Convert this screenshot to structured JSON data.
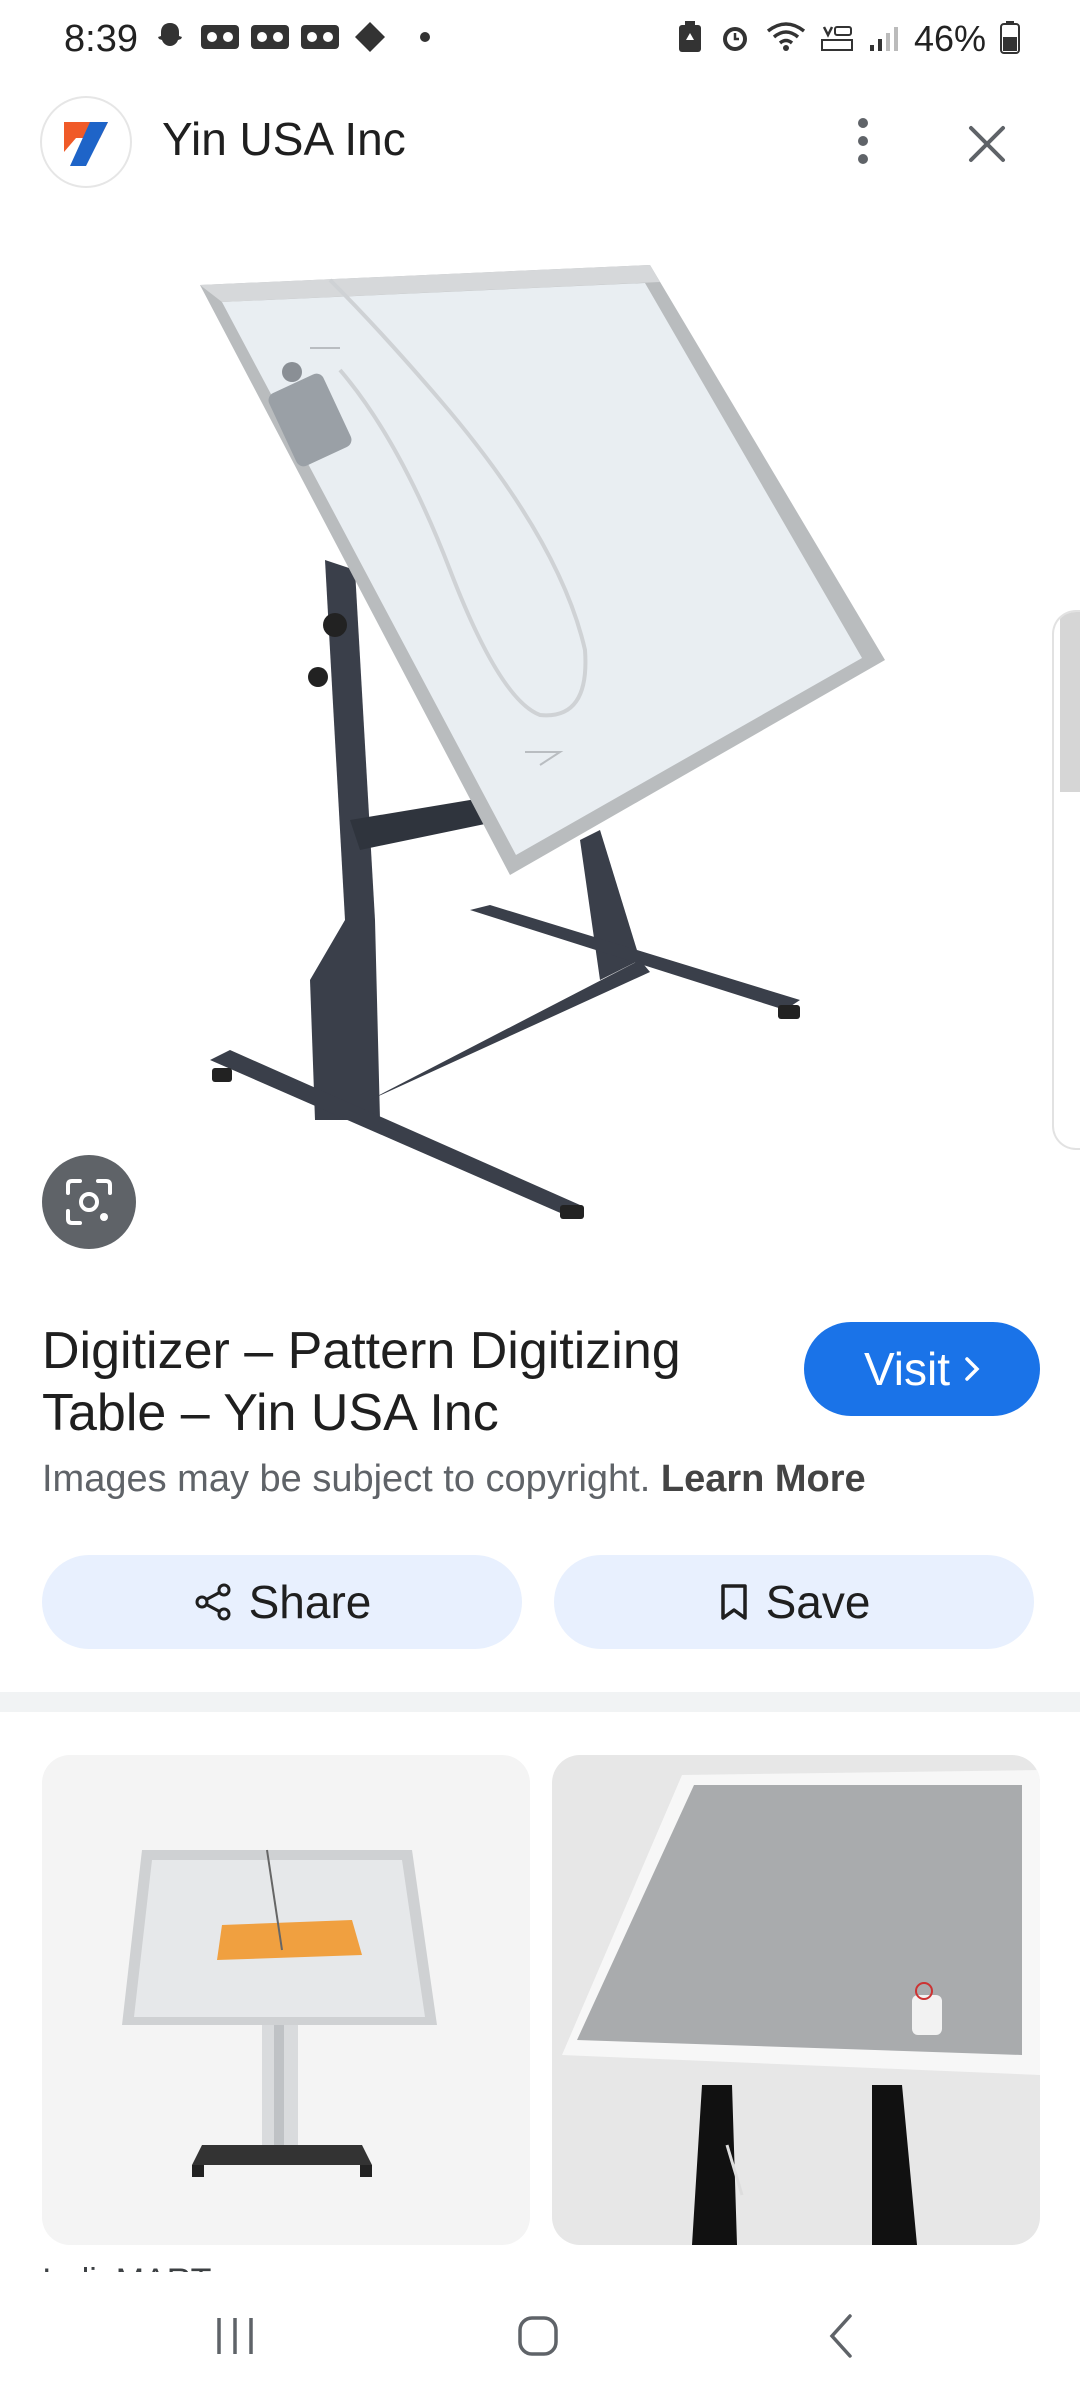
{
  "status_bar": {
    "time": "8:39",
    "battery": "46%",
    "left_icons": [
      "snapchat-icon",
      "voicemail-icon",
      "voicemail-icon",
      "voicemail-icon",
      "diamond-icon"
    ],
    "right_icons": [
      "battery-saver-icon",
      "alarm-icon",
      "wifi-icon",
      "volte-icon",
      "signal-icon",
      "battery-icon"
    ]
  },
  "header": {
    "site_name": "Yin USA Inc"
  },
  "result": {
    "title": "Digitizer – Pattern Digitizing Table – Yin USA Inc",
    "visit_label": "Visit",
    "copyright_text": "Images may be subject to copyright.",
    "learn_more": "Learn More"
  },
  "actions": {
    "share_label": "Share",
    "save_label": "Save"
  },
  "related": {
    "caption_1": "IndiaMART"
  },
  "colors": {
    "accent": "#1a73e8",
    "action_bg": "#e8f0fe",
    "lens_bg": "#5f6368"
  }
}
